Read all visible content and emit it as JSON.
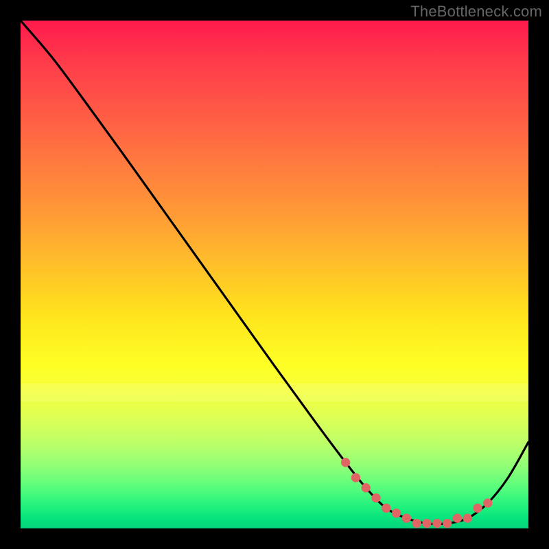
{
  "watermark": "TheBottleneck.com",
  "chart_data": {
    "type": "line",
    "title": "",
    "xlabel": "",
    "ylabel": "",
    "xlim": [
      0,
      100
    ],
    "ylim": [
      0,
      100
    ],
    "grid": false,
    "series": [
      {
        "name": "curve",
        "x": [
          0,
          6,
          12,
          20,
          30,
          40,
          50,
          58,
          64,
          68,
          72,
          76,
          80,
          84,
          88,
          92,
          96,
          100
        ],
        "y": [
          100,
          93,
          85,
          74,
          60,
          46,
          32,
          21,
          13,
          8,
          4,
          2,
          1,
          1,
          2,
          5,
          10,
          17
        ]
      }
    ],
    "markers": {
      "name": "dots",
      "x": [
        64,
        66,
        68,
        70,
        72,
        74,
        76,
        78,
        80,
        82,
        84,
        86,
        88,
        90,
        92
      ],
      "y": [
        13,
        10,
        8,
        6,
        4,
        3,
        2,
        1,
        1,
        1,
        1,
        2,
        2,
        4,
        5
      ]
    },
    "gradient_stops": [
      {
        "pos": 0.0,
        "color": "#ff1a4d"
      },
      {
        "pos": 0.58,
        "color": "#ffe41d"
      },
      {
        "pos": 0.76,
        "color": "#e8ff4b"
      },
      {
        "pos": 0.92,
        "color": "#57fd7d"
      },
      {
        "pos": 1.0,
        "color": "#06d37b"
      }
    ]
  }
}
